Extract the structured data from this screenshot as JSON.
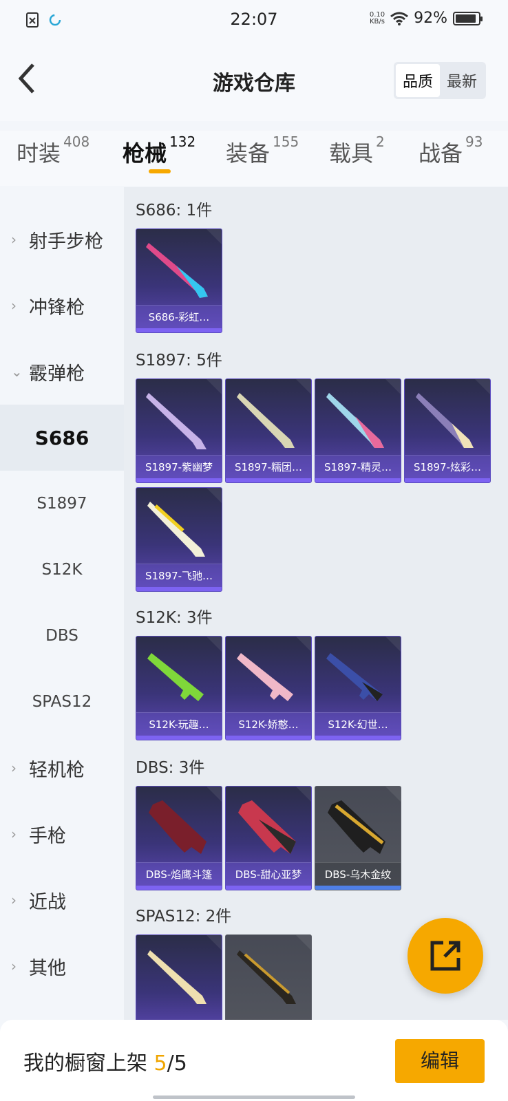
{
  "status_bar": {
    "time": "22:07",
    "net_speed_value": "0.10",
    "net_speed_unit": "KB/s",
    "battery": "92%"
  },
  "header": {
    "title": "游戏仓库",
    "sort_options": [
      "品质",
      "最新"
    ],
    "active_sort": "品质"
  },
  "tabs": [
    {
      "label": "时装",
      "count": "408"
    },
    {
      "label": "枪械",
      "count": "132"
    },
    {
      "label": "装备",
      "count": "155"
    },
    {
      "label": "载具",
      "count": "2"
    },
    {
      "label": "战备",
      "count": "93"
    }
  ],
  "sidebar": {
    "items": [
      "射手步枪",
      "冲锋枪",
      "霰弹枪",
      "S686",
      "S1897",
      "S12K",
      "DBS",
      "SPAS12",
      "轻机枪",
      "手枪",
      "近战",
      "其他"
    ],
    "selected": "S686"
  },
  "groups": [
    {
      "title": "S686: 1件",
      "items": [
        "S686-彩虹…"
      ]
    },
    {
      "title": "S1897: 5件",
      "items": [
        "S1897-紫幽梦",
        "S1897-糯团…",
        "S1897-精灵…",
        "S1897-炫彩…",
        "S1897-飞驰…"
      ]
    },
    {
      "title": "S12K: 3件",
      "items": [
        "S12K-玩趣…",
        "S12K-娇憨…",
        "S12K-幻世…"
      ]
    },
    {
      "title": "DBS: 3件",
      "items": [
        "DBS-焰鹰斗篷",
        "DBS-甜心亚梦",
        "DBS-乌木金纹"
      ]
    },
    {
      "title": "SPAS12: 2件",
      "items": [
        "",
        ""
      ]
    }
  ],
  "bottom_bar": {
    "text_prefix": "我的橱窗上架 ",
    "current": "5",
    "text_suffix": "/5",
    "edit_label": "编辑"
  },
  "colors": {
    "accent": "#f6a800",
    "card_purple": "#5d48b5",
    "card_gray": "#54575f"
  },
  "icons": [
    "close-file-icon",
    "sync-icon",
    "wifi-icon",
    "battery-icon",
    "back-chevron-icon",
    "chevron-right-icon",
    "chevron-down-icon",
    "share-icon"
  ]
}
